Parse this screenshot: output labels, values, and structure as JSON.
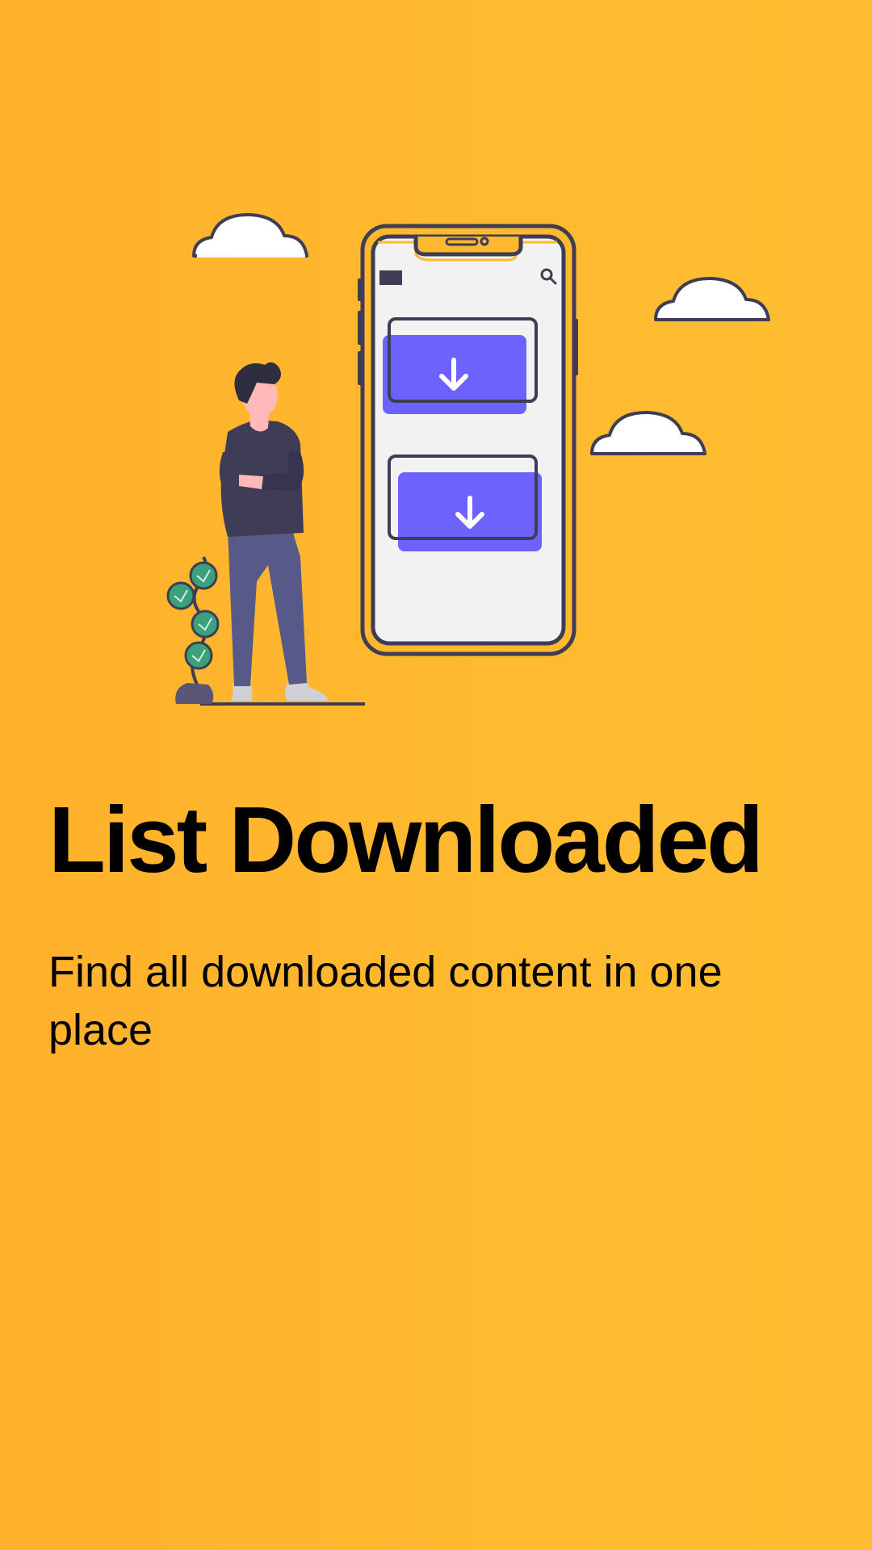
{
  "onboarding": {
    "title": "List Downloaded",
    "subtitle": "Find all downloaded content in one place"
  },
  "colors": {
    "background": "#ffb92f",
    "accent_purple": "#6c63ff",
    "outline": "#3f3d56",
    "cloud": "#ffffff",
    "leaf": "#3ba17c",
    "phone_screen": "#f2f2f2",
    "skin": "#ffb9b9"
  },
  "illustration": {
    "icons": [
      "cloud-icon",
      "phone-illustration",
      "download-arrow-icon",
      "person-illustration",
      "plant-illustration",
      "search-icon",
      "menu-icon"
    ]
  }
}
